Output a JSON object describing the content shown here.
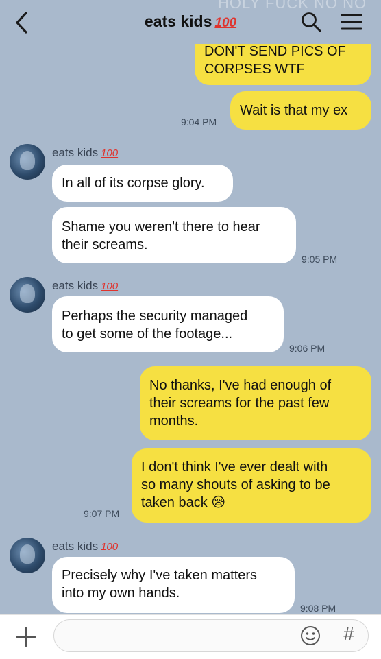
{
  "header": {
    "background_text": "HOLY FUCK NO NO",
    "title": "eats kids",
    "title_emoji": "100",
    "back_icon": "chevron-left-icon",
    "search_icon": "search-icon",
    "menu_icon": "hamburger-menu-icon"
  },
  "messages": [
    {
      "side": "out",
      "text": "DON'T SEND PICS OF\nCORPSES WTF"
    },
    {
      "side": "out",
      "text": "Wait is that my ex",
      "time": "9:04 PM"
    },
    {
      "side": "in",
      "sender": "eats kids",
      "sender_emoji": "100",
      "text": "In all of its corpse glory."
    },
    {
      "side": "in",
      "text": "Shame you weren't there to hear\ntheir screams.",
      "time": "9:05 PM"
    },
    {
      "side": "in",
      "sender": "eats kids",
      "sender_emoji": "100",
      "text": "Perhaps the security managed\nto get some of the footage...",
      "time": "9:06 PM"
    },
    {
      "side": "out",
      "text": "No thanks, I've had enough of\ntheir screams for the past few\nmonths."
    },
    {
      "side": "out",
      "text": "I don't think I've ever dealt with\nso many shouts of asking to be\ntaken back 😪",
      "time": "9:07 PM"
    },
    {
      "side": "in",
      "sender": "eats kids",
      "sender_emoji": "100",
      "text": "Precisely why I've taken matters\ninto my own hands.",
      "time": "9:08 PM"
    }
  ],
  "footer": {
    "input_value": "",
    "input_placeholder": "",
    "plus_icon": "plus-icon",
    "emoji_icon": "smiley-icon",
    "hash_label": "#"
  },
  "colors": {
    "background": "#a9b9cc",
    "outgoing_bubble": "#f6e042",
    "incoming_bubble": "#ffffff",
    "emoji_red": "#e0332d"
  }
}
